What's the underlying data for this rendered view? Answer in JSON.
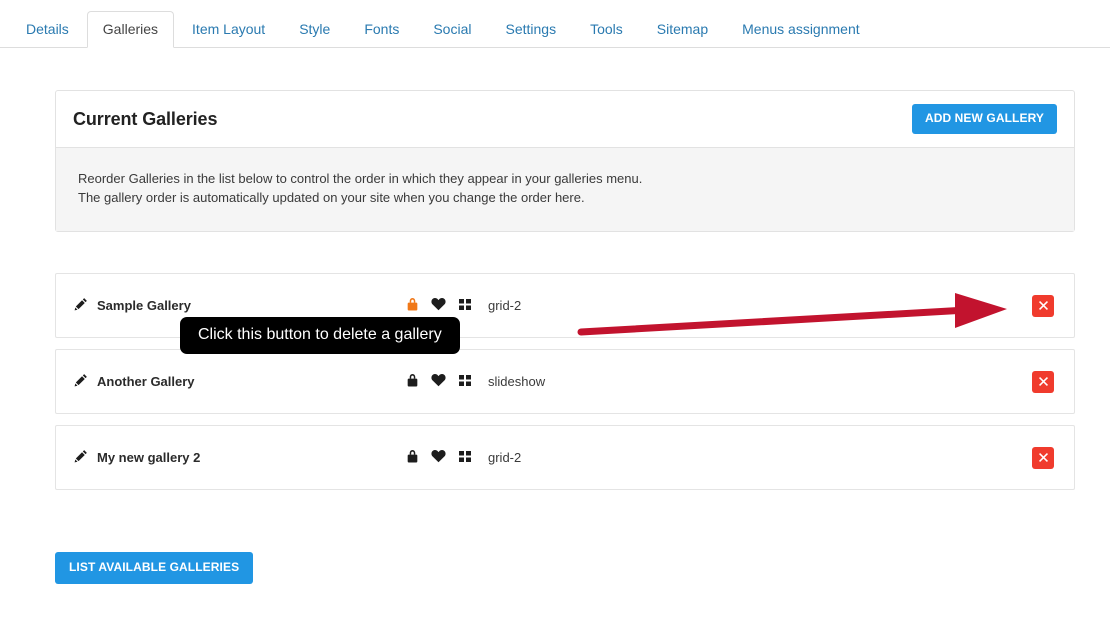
{
  "tabs": [
    {
      "label": "Details",
      "active": false
    },
    {
      "label": "Galleries",
      "active": true
    },
    {
      "label": "Item Layout",
      "active": false
    },
    {
      "label": "Style",
      "active": false
    },
    {
      "label": "Fonts",
      "active": false
    },
    {
      "label": "Social",
      "active": false
    },
    {
      "label": "Settings",
      "active": false
    },
    {
      "label": "Tools",
      "active": false
    },
    {
      "label": "Sitemap",
      "active": false
    },
    {
      "label": "Menus assignment",
      "active": false
    }
  ],
  "panel": {
    "title": "Current Galleries",
    "add_button": "ADD NEW GALLERY",
    "info_line1": "Reorder Galleries in the list below to control the order in which they appear in your galleries menu.",
    "info_line2": "The gallery order is automatically updated on your site when you change the order here."
  },
  "galleries": [
    {
      "name": "Sample Gallery",
      "lock_icon": "lock-icon",
      "lock_color": "#f07818",
      "heart_icon": "heart-icon",
      "layout_icon": "grid-icon",
      "layout_label": "grid-2",
      "delete_label": "×"
    },
    {
      "name": "Another Gallery",
      "lock_icon": "lock-icon",
      "lock_color": "#1d1d1d",
      "heart_icon": "heart-icon",
      "layout_icon": "grid-icon",
      "layout_label": "slideshow",
      "delete_label": "×"
    },
    {
      "name": "My new gallery 2",
      "lock_icon": "lock-icon",
      "lock_color": "#1d1d1d",
      "heart_icon": "heart-icon",
      "layout_icon": "grid-icon",
      "layout_label": "grid-2",
      "delete_label": "×"
    }
  ],
  "footer": {
    "list_button": "LIST AVAILABLE GALLERIES"
  },
  "annotation": {
    "tooltip_text": "Click this button to delete a gallery",
    "arrow_color": "#c2132e",
    "arrow_target": "delete-button-row-1"
  },
  "colors": {
    "accent_blue": "#2196e3",
    "tab_link": "#2a7ab0",
    "danger_red": "#f03b2d",
    "panel_body_gray": "#f5f5f5",
    "border_gray": "#e2e2e2"
  }
}
